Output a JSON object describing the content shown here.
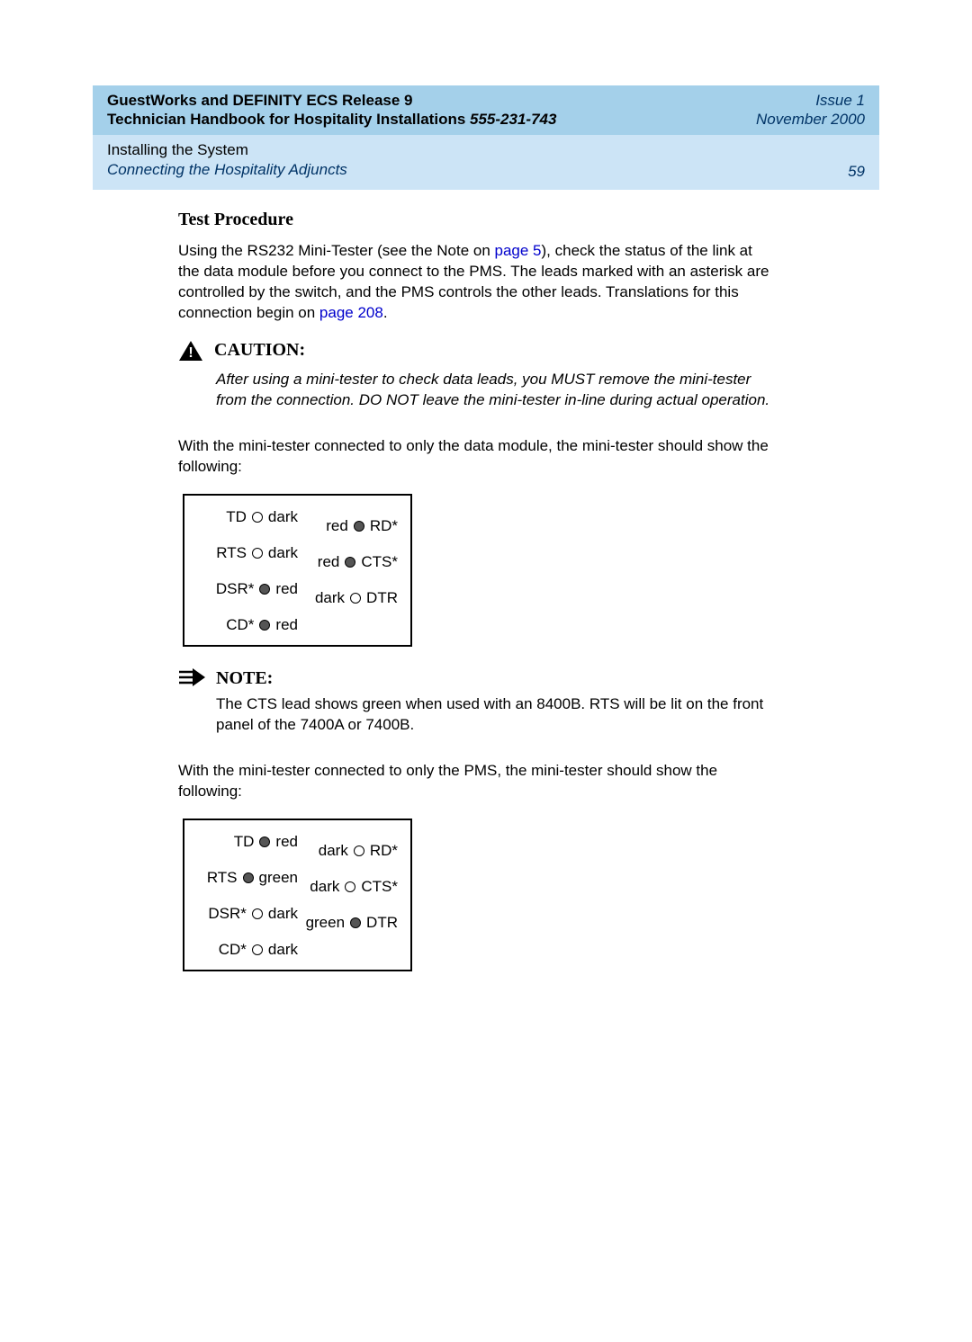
{
  "header": {
    "line1": "GuestWorks and DEFINITY ECS Release 9",
    "line2a": "Technician Handbook for Hospitality Installations  ",
    "docnum": "555-231-743",
    "issue": "Issue 1",
    "date": "November 2000",
    "section_line1": "Installing the System",
    "section_line2": "Connecting the Hospitality Adjuncts",
    "page": "59"
  },
  "heading": "Test Procedure",
  "intro_a": "Using the RS232 Mini-Tester (see the Note on ",
  "intro_link1": "page 5",
  "intro_b": "), check the status of the link at the data module before you connect to the PMS. The leads marked with an asterisk are controlled by the switch, and the PMS controls the other leads. Translations for this connection begin on ",
  "intro_link2": "page 208",
  "intro_c": ".",
  "caution_label": "CAUTION:",
  "caution_body": "After using a mini-tester to check data leads, you MUST remove the mini-tester from the connection. DO NOT leave the mini-tester in-line during actual operation.",
  "para_module": "With the mini-tester connected to only the data module, the mini-tester should show the following:",
  "note_label": "NOTE:",
  "note_body": "The CTS lead shows green when used with an 8400B. RTS will be lit on the front panel of the 7400A or 7400B.",
  "para_pms": "With the mini-tester connected to only the PMS, the mini-tester should show the following:",
  "led_module": {
    "TD": {
      "state": "dark",
      "filled": false
    },
    "RD": {
      "state": "red",
      "filled": true,
      "label": "RD*"
    },
    "RTS": {
      "state": "dark",
      "filled": false
    },
    "CTS": {
      "state": "red",
      "filled": true,
      "label": "CTS*"
    },
    "DSR": {
      "state": "red",
      "filled": true,
      "label": "DSR*"
    },
    "DTR": {
      "state": "dark",
      "filled": false,
      "label": "DTR"
    },
    "CD": {
      "state": "red",
      "filled": true,
      "label": "CD*"
    }
  },
  "led_pms": {
    "TD": {
      "state": "red",
      "filled": true
    },
    "RD": {
      "state": "dark",
      "filled": false,
      "label": "RD*"
    },
    "RTS": {
      "state": "green",
      "filled": true
    },
    "CTS": {
      "state": "dark",
      "filled": false,
      "label": "CTS*"
    },
    "DSR": {
      "state": "dark",
      "filled": false,
      "label": "DSR*"
    },
    "DTR": {
      "state": "green",
      "filled": true,
      "label": "DTR"
    },
    "CD": {
      "state": "dark",
      "filled": false,
      "label": "CD*"
    }
  }
}
